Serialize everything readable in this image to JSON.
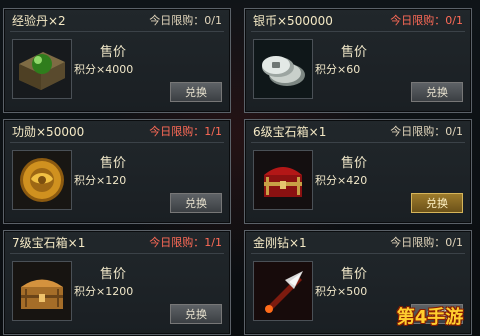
{
  "cards": [
    {
      "name": "经验丹×2",
      "limit": "今日限购：0/1",
      "limit_color": "#e3d7bd",
      "price_label": "售价",
      "price_text": "积分×4000",
      "button_label": "兑换",
      "icon": "green-pill-box-icon",
      "button_active": false
    },
    {
      "name": "银币×500000",
      "limit": "今日限购：0/1",
      "limit_color": "#ff6b57",
      "price_label": "售价",
      "price_text": "积分×60",
      "button_label": "兑换",
      "icon": "silver-coins-icon",
      "button_active": false
    },
    {
      "name": "功勋×50000",
      "limit": "今日限购：1/1",
      "limit_color": "#ff6b57",
      "price_label": "售价",
      "price_text": "积分×120",
      "button_label": "兑换",
      "icon": "gold-medallion-icon",
      "button_active": false
    },
    {
      "name": "6级宝石箱×1",
      "limit": "今日限购：0/1",
      "limit_color": "#e3d7bd",
      "price_label": "售价",
      "price_text": "积分×420",
      "button_label": "兑换",
      "icon": "red-chest-icon",
      "button_active": true
    },
    {
      "name": "7级宝石箱×1",
      "limit": "今日限购：1/1",
      "limit_color": "#ff6b57",
      "price_label": "售价",
      "price_text": "积分×1200",
      "button_label": "兑换",
      "icon": "wood-chest-icon",
      "button_active": false
    },
    {
      "name": "金刚钻×1",
      "limit": "今日限购：0/1",
      "limit_color": "#e3d7bd",
      "price_label": "售价",
      "price_text": "积分×500",
      "button_label": "兑换",
      "icon": "spear-tip-icon",
      "button_active": false
    }
  ],
  "watermark": "第4手游"
}
